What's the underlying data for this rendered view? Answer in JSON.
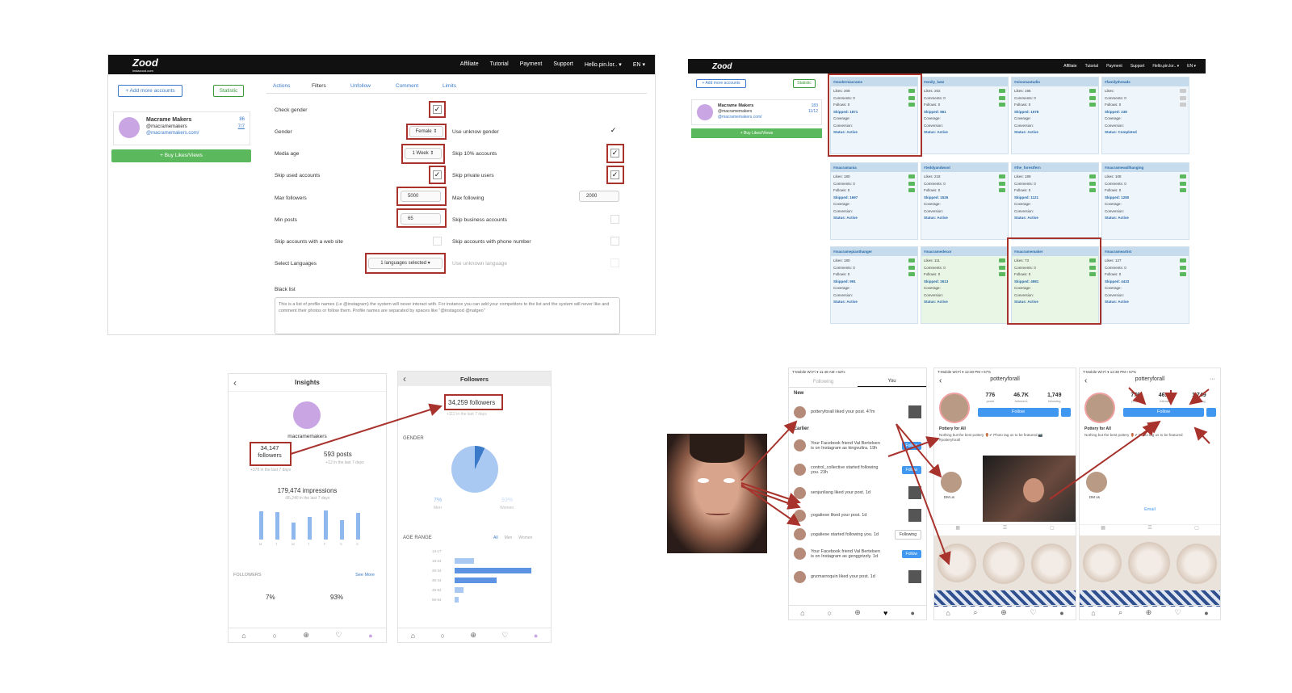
{
  "instazood": {
    "logo": "Zood",
    "logo_sub": "instazood.com",
    "nav": [
      "Affiliate",
      "Tutorial",
      "Payment",
      "Support",
      "Hello.pin.lor.. ▾",
      "EN ▾"
    ],
    "add_accounts": "+ Add more accounts",
    "statistic": "Statistic",
    "account_name": "Macrame Makers",
    "account_handle": "@macramemakers",
    "account_url": "@macramemakers.com/",
    "counts": [
      "86",
      "7/7"
    ],
    "buy": "+ Buy Likes/Views",
    "tabs": [
      "Actions",
      "Filters",
      "Unfollow",
      "Comment",
      "Limits"
    ],
    "labels": {
      "check_gender": "Check gender",
      "gender": "Gender",
      "use_unknow_gender": "Use unknow gender",
      "media_age": "Media age",
      "skip_10": "Skip 10% accounts",
      "skip_used": "Skip used accounts",
      "skip_private": "Skip private users",
      "max_followers": "Max followers",
      "max_following": "Max following",
      "min_posts": "Min posts",
      "skip_business": "Skip business accounts",
      "skip_web": "Skip accounts with a web site",
      "skip_phone": "Skip accounts with phone number",
      "select_languages": "Select Languages",
      "use_unknown_language": "Use unknown language",
      "black_list": "Black list"
    },
    "values": {
      "gender": "Female ⇕",
      "media_age": "1 Week  ⇕",
      "max_followers": "5000",
      "max_following": "2000",
      "min_posts": "65",
      "languages": "1 languages selected ▾"
    },
    "black_list_text": "This is a list of profile names (i.e @instagram) the system will never interact with. For instance you can add your competitors to the list and the system will never like and comment their photos or follow them. Profile names are separated by spaces like \"@instagood @natgeo\""
  },
  "dashboard": {
    "add_accounts": "+ Add more accounts",
    "statistic": "Statistic",
    "account_name": "Macrame Makers",
    "account_handle": "@macramemakers",
    "account_url": "@macramemakers.com/",
    "counts": [
      "183",
      "11/12"
    ],
    "buy": "+ Buy Likes/Views",
    "tiles": [
      {
        "name": "#moderniacrame",
        "likes": "Likes: 209",
        "skipped": "Skipped: 1871",
        "status": "Status: Active"
      },
      {
        "name": "#emily_katz",
        "likes": "Likes: 202",
        "skipped": "Skipped: 861",
        "status": "Status: Active"
      },
      {
        "name": "#ninomastudio",
        "likes": "Likes: 195",
        "skipped": "Skipped: 1578",
        "status": "Status: Active"
      },
      {
        "name": "#familythreads",
        "likes": "Likes:",
        "skipped": "Skipped: 238",
        "status": "Status: Completed"
      },
      {
        "name": "#macramania",
        "likes": "Likes: 180",
        "skipped": "Skipped: 1697",
        "status": "Status: Active"
      },
      {
        "name": "#teddyandwool",
        "likes": "Likes: 218",
        "skipped": "Skipped: 1526",
        "status": "Status: Active"
      },
      {
        "name": "#the_forestfern",
        "likes": "Likes: 189",
        "skipped": "Skipped: 1121",
        "status": "Status: Active"
      },
      {
        "name": "#macramewallhanging",
        "likes": "Likes: 108",
        "skipped": "Skipped: 1280",
        "status": "Status: Active"
      },
      {
        "name": "#macramepianthanger",
        "likes": "Likes: 180",
        "skipped": "Skipped: 991",
        "status": "Status: Active"
      },
      {
        "name": "#macramedecor",
        "likes": "Likes: 111",
        "skipped": "Skipped: 2613",
        "status": "Status: Active"
      },
      {
        "name": "#macramemaker",
        "likes": "Likes: 73",
        "skipped": "Skipped: 4981",
        "status": "Status: Active"
      },
      {
        "name": "#macrameartist",
        "likes": "Likes: 127",
        "skipped": "Skipped: 4433",
        "status": "Status: Active"
      }
    ],
    "row_labels": [
      "Comments: 0",
      "Follows: 0",
      "Coverage:",
      "Conversion:"
    ]
  },
  "insights": {
    "title": "Insights",
    "username": "macramemakers",
    "followers": "34,147",
    "followers_label": "followers",
    "followers_sub": "+378 in the last 7 days",
    "posts": "593 posts",
    "posts_sub": "+12 in the last 7 days",
    "impressions": "179,474 impressions",
    "impressions_sub": "-85,240 in the last 7 days",
    "days": [
      "M",
      "T",
      "W",
      "T",
      "F",
      "S",
      "S"
    ],
    "bars": [
      0.62,
      0.6,
      0.38,
      0.5,
      0.64,
      0.42,
      0.58
    ],
    "followers_section": "FOLLOWERS",
    "see_more": "See More",
    "pct_men": "7%",
    "pct_women": "93%"
  },
  "followers_screen": {
    "title": "Followers",
    "count": "34,259 followers",
    "sub": "+112 in the last 7 days",
    "gender_title": "GENDER",
    "men_pct": "7%",
    "men": "Men",
    "women_pct": "93%",
    "women": "Women",
    "age_title": "AGE RANGE",
    "age_filters": [
      "All",
      "Men",
      "Women"
    ],
    "age_labels": [
      "13-17",
      "18-24",
      "25-34",
      "35-44",
      "45-54",
      "55-64"
    ],
    "age_values": [
      0,
      0.25,
      1.0,
      0.55,
      0.12,
      0.05
    ]
  },
  "activity": {
    "status": "T-Mobile Wi-Fi ▾   11:48 AM   ▪ 62%",
    "tabs": [
      "Following",
      "You"
    ],
    "new": "New",
    "earlier": "Earlier",
    "items": [
      {
        "text": "potteryforall liked your post. 47m",
        "type": "thumb"
      },
      {
        "text": "Your Facebook friend Val Bertelsen is on Instagram as kingvultra. 19h",
        "type": "follow"
      },
      {
        "text": "control_collective started following you. 23h",
        "type": "follow"
      },
      {
        "text": "senjunliang liked your post. 1d",
        "type": "thumb"
      },
      {
        "text": "yogaliese liked your post. 1d",
        "type": "thumb"
      },
      {
        "text": "yogaliese started following you. 1d",
        "type": "following"
      },
      {
        "text": "Your Facebook friend Val Bertelsen is on Instagram as genggrizzly. 1d",
        "type": "follow"
      },
      {
        "text": "gnzmarroquin liked your post. 1d",
        "type": "thumb"
      }
    ],
    "follow_label": "Follow",
    "following_label": "Following"
  },
  "profile1": {
    "status": "T-Mobile Wi-Fi ▾   12:30 PM   ▪ 57%",
    "username": "potteryforall",
    "stats": [
      {
        "n": "776",
        "l": "posts"
      },
      {
        "n": "46.7K",
        "l": "followers"
      },
      {
        "n": "1,749",
        "l": "following"
      }
    ],
    "follow": "Follow",
    "name": "Pottery for All",
    "bio": "Nothing but the best pottery 🏺✔ Photo tag us to be featured 📷 #potteryforall",
    "highlight": "DM us"
  },
  "profile2": {
    "status": "T-Mobile Wi-Fi ▾   12:30 PM   ▪ 57%",
    "username": "potteryforall",
    "stats": [
      {
        "n": "776",
        "l": "posts"
      },
      {
        "n": "46.7K",
        "l": "followers"
      },
      {
        "n": "1,749",
        "l": "following"
      }
    ],
    "follow": "Follow",
    "name": "Pottery for All",
    "bio": "Nothing but the best pottery 🏺✔ Photo tag us to be featured",
    "highlight": "DM us",
    "email": "Email"
  },
  "colors": {
    "accent_red": "#a8322c",
    "ig_blue": "#3f97f0",
    "green": "#5cb85c",
    "bar_blue": "#8fb8ef"
  }
}
